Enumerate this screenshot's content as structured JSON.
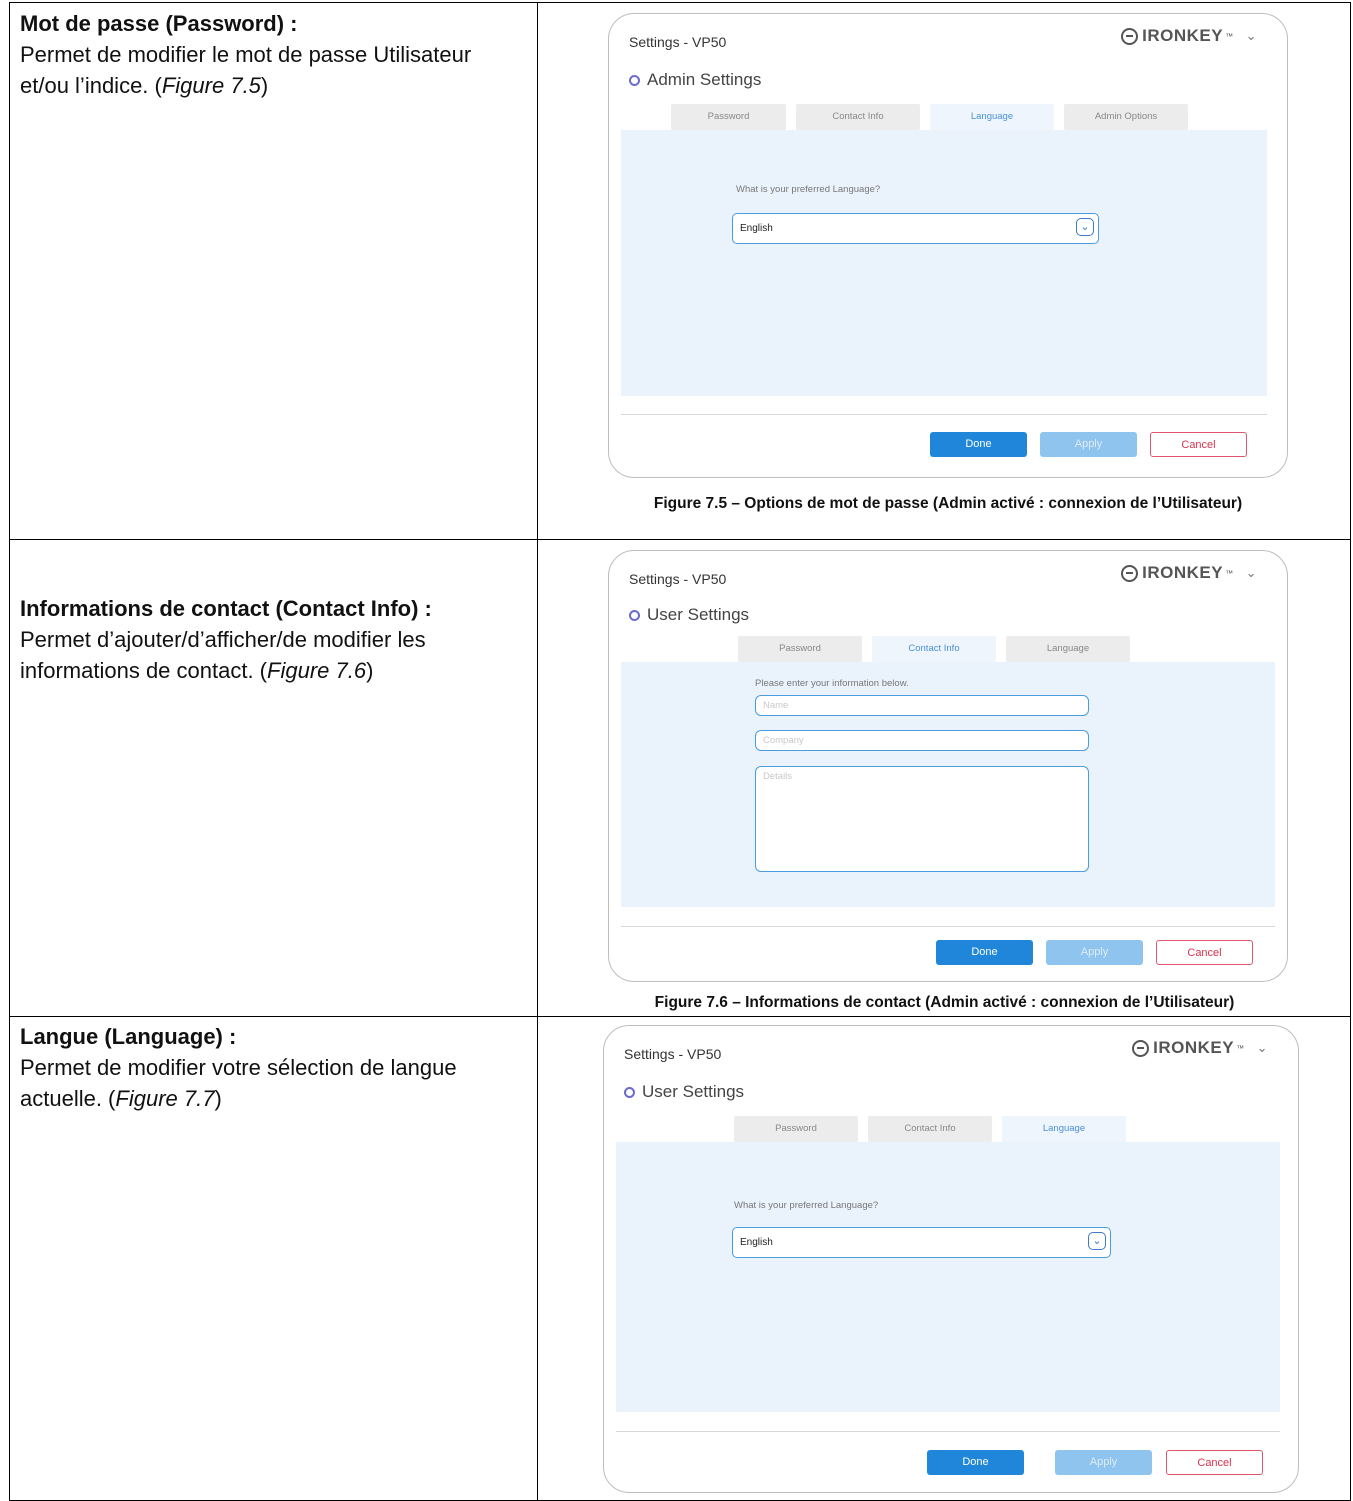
{
  "rows": [
    {
      "heading": "Mot de passe (Password) :",
      "body_pre": "Permet de modifier le mot de passe Utilisateur et/ou l’indice. (",
      "body_ref": "Figure 7.5",
      "body_post": ")",
      "caption": "Figure 7.5 – Options de mot de passe (Admin activé : connexion de l’Utilisateur)",
      "window": {
        "title": "Settings - VP50",
        "brand": "IRONKEY",
        "section": "Admin Settings",
        "tabs": [
          "Password",
          "Contact Info",
          "Language",
          "Admin Options"
        ],
        "active_tab": "Language",
        "prompt": "What is your preferred Language?",
        "selected_language": "English",
        "buttons": {
          "done": "Done",
          "apply": "Apply",
          "cancel": "Cancel"
        }
      }
    },
    {
      "heading": "Informations de contact (Contact Info) :",
      "body_pre": "Permet d’ajouter/d’afficher/de modifier les informations de contact. (",
      "body_ref": "Figure 7.6",
      "body_post": ")",
      "caption": "Figure 7.6 – Informations de contact (Admin activé : connexion de l’Utilisateur)",
      "window": {
        "title": "Settings - VP50",
        "brand": "IRONKEY",
        "section": "User Settings",
        "tabs": [
          "Password",
          "Contact Info",
          "Language"
        ],
        "active_tab": "Contact Info",
        "prompt": "Please enter your information below.",
        "fields": {
          "name": "Name",
          "company": "Company",
          "details": "Details"
        },
        "buttons": {
          "done": "Done",
          "apply": "Apply",
          "cancel": "Cancel"
        }
      }
    },
    {
      "heading": "Langue (Language) :",
      "body_pre": "Permet de modifier votre sélection de langue actuelle. (",
      "body_ref": "Figure 7.7",
      "body_post": ")",
      "window": {
        "title": "Settings - VP50",
        "brand": "IRONKEY",
        "section": "User Settings",
        "tabs": [
          "Password",
          "Contact Info",
          "Language"
        ],
        "active_tab": "Language",
        "prompt": "What is your preferred Language?",
        "selected_language": "English",
        "buttons": {
          "done": "Done",
          "apply": "Apply",
          "cancel": "Cancel"
        }
      }
    }
  ],
  "icons": [
    "ironkey-logo-icon",
    "gear-icon",
    "chevron-down-icon",
    "dropdown-arrow-icon"
  ]
}
